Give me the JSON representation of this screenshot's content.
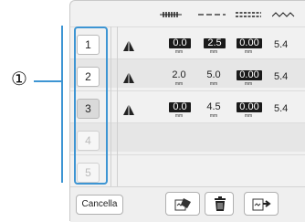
{
  "callout": {
    "marker": "①"
  },
  "header": {
    "col_icons": [
      "zigzag-stitch-icon",
      "dashed-stitch-icon",
      "satin-stitch-icon",
      "wave-stitch-icon"
    ]
  },
  "rows": [
    {
      "number": "1",
      "state": "normal",
      "width": "0.0",
      "length": "2.5",
      "density": "0.00",
      "unit": "mm",
      "extra": "5.4",
      "boxed": [
        true,
        true,
        true
      ]
    },
    {
      "number": "2",
      "state": "normal",
      "width": "2.0",
      "length": "5.0",
      "density": "0.00",
      "unit": "mm",
      "extra": "5.4",
      "boxed": [
        false,
        false,
        true
      ]
    },
    {
      "number": "3",
      "state": "active",
      "width": "0.0",
      "length": "4.5",
      "density": "0.00",
      "unit": "mm",
      "extra": "5.4",
      "boxed": [
        true,
        false,
        true
      ]
    },
    {
      "number": "4",
      "state": "disabled"
    },
    {
      "number": "5",
      "state": "disabled"
    }
  ],
  "bottom": {
    "cancel_label": "Cancella",
    "icons": [
      "clear-pattern-icon",
      "trash-icon",
      "insert-pattern-icon"
    ]
  },
  "colors": {
    "accent": "#3d95d3",
    "panel": "#f1f1f1"
  }
}
